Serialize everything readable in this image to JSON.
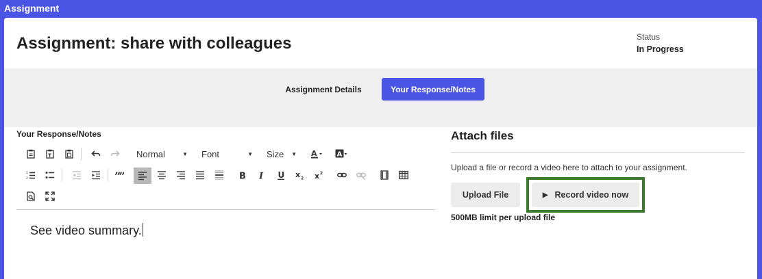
{
  "window": {
    "title": "Assignment"
  },
  "header": {
    "title": "Assignment: share with colleagues",
    "status_label": "Status",
    "status_value": "In Progress"
  },
  "tabs": [
    {
      "label": "Assignment Details",
      "active": false
    },
    {
      "label": "Your Response/Notes",
      "active": true
    }
  ],
  "editor": {
    "label": "Your Response/Notes",
    "format_select": "Normal",
    "font_select": "Font",
    "size_select": "Size",
    "content": "See video summary."
  },
  "attach": {
    "title": "Attach files",
    "description": "Upload a file or record a video here to attach to your assignment.",
    "upload_label": "Upload File",
    "record_label": "Record video now",
    "limit": "500MB limit per upload file"
  },
  "colors": {
    "accent": "#4a55e6",
    "highlight_border": "#3c7a2f",
    "button_bg": "#ececec"
  }
}
